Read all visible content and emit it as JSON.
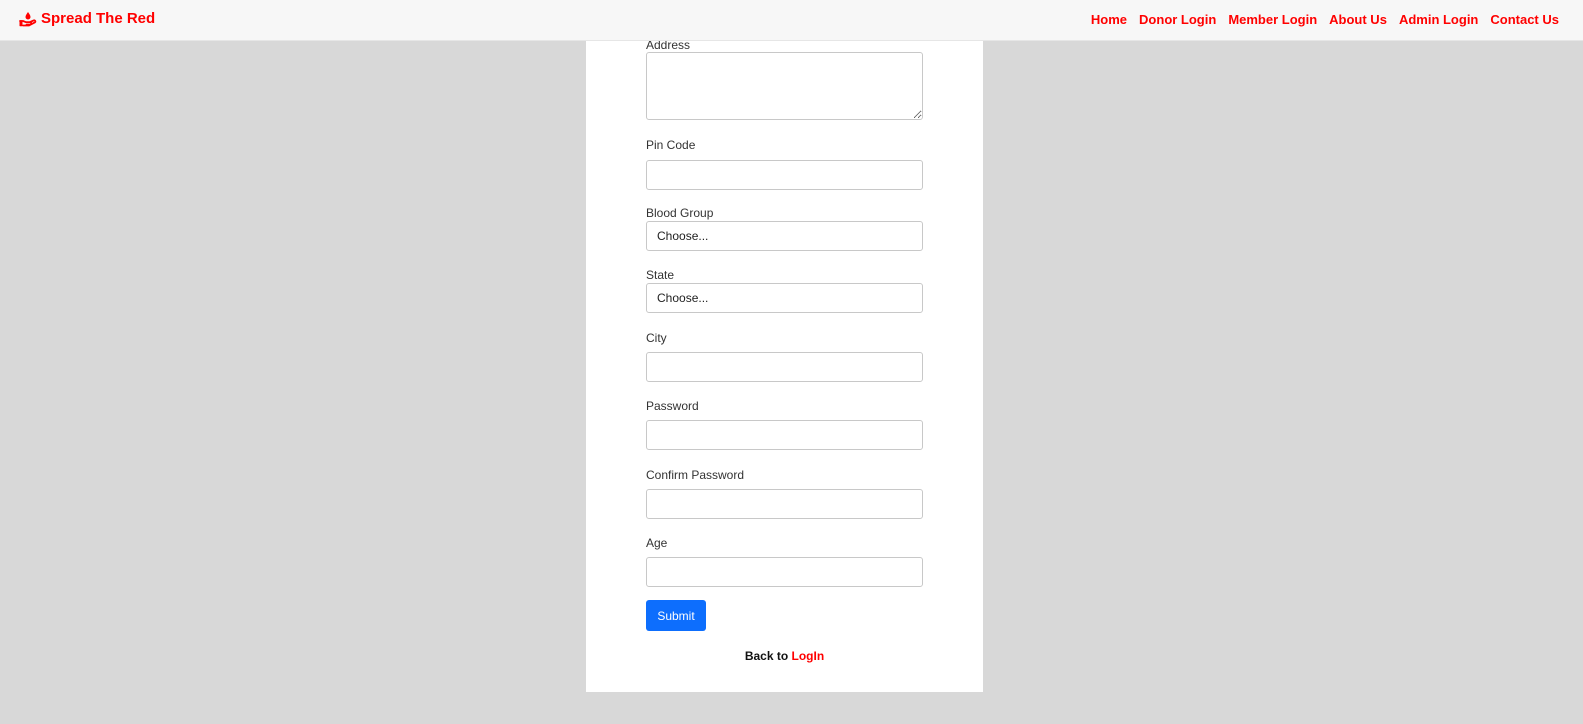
{
  "navbar": {
    "brand": "Spread The Red",
    "brand_icon": "hand-drop-icon",
    "links": [
      "Home",
      "Donor Login",
      "Member Login",
      "About Us",
      "Admin Login",
      "Contact Us"
    ],
    "accent_color": "#ff0000"
  },
  "form": {
    "address_label": "Address",
    "address_value": "",
    "pin_code_label": "Pin Code",
    "pin_code_value": "",
    "blood_group_label": "Blood Group",
    "blood_group_selected": "Choose...",
    "state_label": "State",
    "state_selected": "Choose...",
    "city_label": "City",
    "city_value": "",
    "password_label": "Password",
    "password_value": "",
    "confirm_password_label": "Confirm Password",
    "confirm_password_value": "",
    "age_label": "Age",
    "age_value": "",
    "submit_label": "Submit",
    "submit_color": "#0d6efd",
    "back_text": "Back to",
    "back_link": "LogIn"
  }
}
